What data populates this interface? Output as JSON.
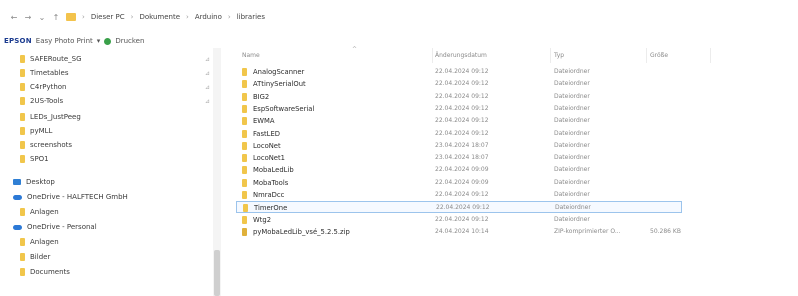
{
  "address_bar": {
    "nav": [
      "←",
      "→",
      "⌄",
      "↑"
    ],
    "breadcrumb": [
      "Dieser PC",
      "Dokumente",
      "Arduino",
      "libraries"
    ],
    "separator": "›"
  },
  "epson_bar": {
    "brand": "EPSON",
    "app_label": "Easy Photo Print",
    "print_label": "Drucken"
  },
  "sidebar": {
    "items": [
      {
        "label": "SAFERoute_SG",
        "icon": "folder-icon",
        "pinned": true
      },
      {
        "label": "Timetables",
        "icon": "folder-icon",
        "pinned": true
      },
      {
        "label": "C4rPython",
        "icon": "folder-icon",
        "pinned": true
      },
      {
        "label": "2US-Tools",
        "icon": "folder-icon",
        "pinned": true
      },
      {
        "label": "LEDs_JustPeeg",
        "icon": "folder-icon",
        "pinned": false
      },
      {
        "label": "pyMLL",
        "icon": "folder-icon",
        "pinned": false
      },
      {
        "label": "screenshots",
        "icon": "folder-icon",
        "pinned": false
      },
      {
        "label": "SPO1",
        "icon": "folder-icon",
        "pinned": false
      },
      {
        "label": "Desktop",
        "icon": "desktop-icon",
        "pinned": false
      },
      {
        "label": "OneDrive - HALFTECH GmbH",
        "icon": "cloud-icon",
        "pinned": false
      },
      {
        "label": "Anlagen",
        "icon": "folder-icon",
        "pinned": false
      },
      {
        "label": "OneDrive - Personal",
        "icon": "cloud-icon",
        "pinned": false
      },
      {
        "label": "Anlagen",
        "icon": "folder-icon",
        "pinned": false
      },
      {
        "label": "Bilder",
        "icon": "folder-icon",
        "pinned": false
      },
      {
        "label": "Documents",
        "icon": "folder-icon",
        "pinned": false
      }
    ]
  },
  "columns": {
    "name": "Name",
    "date": "Änderungsdatum",
    "type": "Typ",
    "size": "Größe"
  },
  "files": [
    {
      "name": "AnalogScanner",
      "date": "22.04.2024 09:12",
      "type": "Dateiordner",
      "size": ""
    },
    {
      "name": "ATtinySerialOut",
      "date": "22.04.2024 09:12",
      "type": "Dateiordner",
      "size": ""
    },
    {
      "name": "BIG2",
      "date": "22.04.2024 09:12",
      "type": "Dateiordner",
      "size": ""
    },
    {
      "name": "EspSoftwareSerial",
      "date": "22.04.2024 09:12",
      "type": "Dateiordner",
      "size": ""
    },
    {
      "name": "EWMA",
      "date": "22.04.2024 09:12",
      "type": "Dateiordner",
      "size": ""
    },
    {
      "name": "FastLED",
      "date": "22.04.2024 09:12",
      "type": "Dateiordner",
      "size": ""
    },
    {
      "name": "LocoNet",
      "date": "23.04.2024 18:07",
      "type": "Dateiordner",
      "size": ""
    },
    {
      "name": "LocoNet1",
      "date": "23.04.2024 18:07",
      "type": "Dateiordner",
      "size": ""
    },
    {
      "name": "MobaLedLib",
      "date": "22.04.2024 09:09",
      "type": "Dateiordner",
      "size": ""
    },
    {
      "name": "MobaTools",
      "date": "22.04.2024 09:09",
      "type": "Dateiordner",
      "size": ""
    },
    {
      "name": "NmraDcc",
      "date": "22.04.2024 09:12",
      "type": "Dateiordner",
      "size": ""
    },
    {
      "name": "TimerOne",
      "date": "22.04.2024 09:12",
      "type": "Dateiordner",
      "size": "",
      "selected": true
    },
    {
      "name": "Wtg2",
      "date": "22.04.2024 09:12",
      "type": "Dateiordner",
      "size": ""
    },
    {
      "name": "pyMobaLedLib_vsé_5.2.5.zip",
      "date": "24.04.2024 10:14",
      "type": "ZIP-komprimierter O...",
      "size": "50.286 KB",
      "zip": true
    }
  ]
}
